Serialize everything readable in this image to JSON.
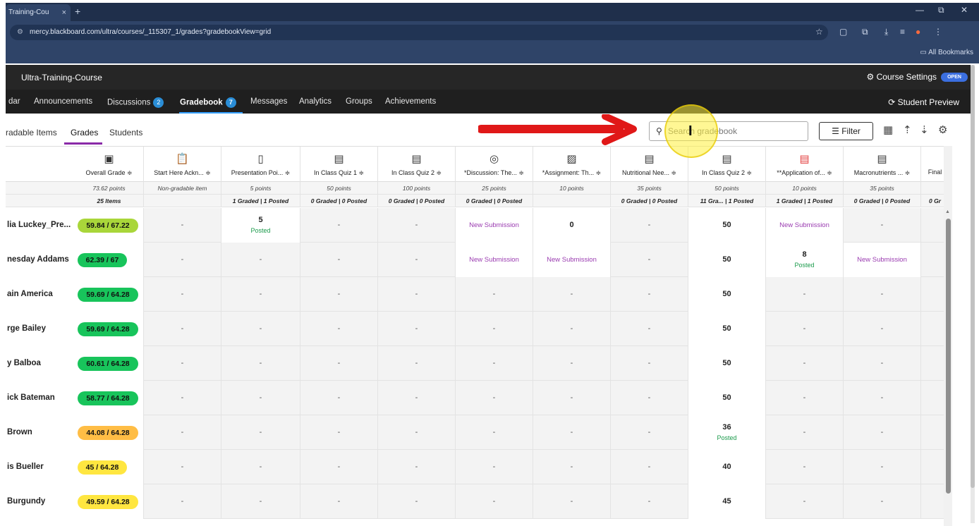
{
  "browser": {
    "tab_title": "Training-Cou",
    "tab_close": "×",
    "new_tab": "+",
    "url": "mercy.blackboard.com/ultra/courses/_115307_1/grades?gradebookView=grid",
    "bookmarks_label": "All Bookmarks",
    "minimize": "—",
    "restore": "⧉",
    "close": "✕"
  },
  "course": {
    "title": "Ultra-Training-Course",
    "settings_label": "Course Settings",
    "open_badge": "OPEN",
    "student_preview": "Student Preview"
  },
  "nav": {
    "items": [
      {
        "label": "dar"
      },
      {
        "label": "Announcements"
      },
      {
        "label": "Discussions",
        "badge": "2"
      },
      {
        "label": "Gradebook",
        "badge": "7"
      },
      {
        "label": "Messages"
      },
      {
        "label": "Analytics"
      },
      {
        "label": "Groups"
      },
      {
        "label": "Achievements"
      }
    ]
  },
  "subtabs": [
    "radable Items",
    "Grades",
    "Students"
  ],
  "search": {
    "placeholder": "Search gradebook"
  },
  "filter_label": "Filter",
  "columns": [
    {
      "name": "Overall Grade ≑",
      "points": "73.62 points",
      "status": "25 Items",
      "icon": "overall-grade-icon"
    },
    {
      "name": "Start Here Ackn... ≑",
      "points": "Non-gradable item",
      "status": "",
      "icon": "clipboard-icon"
    },
    {
      "name": "Presentation Poi... ≑",
      "points": "5 points",
      "status": "1 Graded | 1 Posted",
      "icon": "document-icon"
    },
    {
      "name": "In Class Quiz 1 ≑",
      "points": "50 points",
      "status": "0 Graded | 0 Posted",
      "icon": "quiz-icon"
    },
    {
      "name": "In Class Quiz 2 ≑",
      "points": "100 points",
      "status": "0 Graded | 0 Posted",
      "icon": "quiz-icon"
    },
    {
      "name": "*Discussion: The... ≑",
      "points": "25 points",
      "status": "0 Graded | 0 Posted",
      "icon": "discussion-icon"
    },
    {
      "name": "*Assignment: Th... ≑",
      "points": "10 points",
      "status": "",
      "icon": "assignment-icon"
    },
    {
      "name": "Nutritional Nee... ≑",
      "points": "35 points",
      "status": "0 Graded | 0 Posted",
      "icon": "quiz-icon"
    },
    {
      "name": "In Class Quiz 2 ≑",
      "points": "50 points",
      "status": "11 Gra... | 1 Posted",
      "icon": "quiz-icon"
    },
    {
      "name": "**Application of... ≑",
      "points": "10 points",
      "status": "1 Graded | 1 Posted",
      "icon": "assignment-red-icon"
    },
    {
      "name": "Macronutrients ... ≑",
      "points": "35 points",
      "status": "0 Graded | 0 Posted",
      "icon": "quiz-icon"
    },
    {
      "name": "Final",
      "points": "",
      "status": "0 Gr",
      "icon": ""
    }
  ],
  "students": [
    {
      "name": "lia Luckey_Pre...",
      "overall": "59.84 / 67.22",
      "color": "lime",
      "cells": [
        "-",
        "5|Posted",
        "-",
        "-",
        "New Submission",
        "0",
        "-",
        "50",
        "New Submission",
        "-"
      ]
    },
    {
      "name": "nesday Addams",
      "overall": "62.39 / 67",
      "color": "green",
      "cells": [
        "-",
        "-",
        "-",
        "-",
        "New Submission",
        "New Submission",
        "-",
        "50",
        "8|Posted",
        "New Submission"
      ]
    },
    {
      "name": "ain America",
      "overall": "59.69 / 64.28",
      "color": "green",
      "cells": [
        "-",
        "-",
        "-",
        "-",
        "-",
        "-",
        "-",
        "50",
        "-",
        "-"
      ]
    },
    {
      "name": "rge Bailey",
      "overall": "59.69 / 64.28",
      "color": "green",
      "cells": [
        "-",
        "-",
        "-",
        "-",
        "-",
        "-",
        "-",
        "50",
        "-",
        "-"
      ]
    },
    {
      "name": "y Balboa",
      "overall": "60.61 / 64.28",
      "color": "green",
      "cells": [
        "-",
        "-",
        "-",
        "-",
        "-",
        "-",
        "-",
        "50",
        "-",
        "-"
      ]
    },
    {
      "name": "ick Bateman",
      "overall": "58.77 / 64.28",
      "color": "green",
      "cells": [
        "-",
        "-",
        "-",
        "-",
        "-",
        "-",
        "-",
        "50",
        "-",
        "-"
      ]
    },
    {
      "name": "Brown",
      "overall": "44.08 / 64.28",
      "color": "orange",
      "cells": [
        "-",
        "-",
        "-",
        "-",
        "-",
        "-",
        "-",
        "36|Posted",
        "-",
        "-"
      ]
    },
    {
      "name": "is Bueller",
      "overall": "45 / 64.28",
      "color": "yellow",
      "cells": [
        "-",
        "-",
        "-",
        "-",
        "-",
        "-",
        "-",
        "40",
        "-",
        "-"
      ]
    },
    {
      "name": "Burgundy",
      "overall": "49.59 / 64.28",
      "color": "yellow",
      "cells": [
        "-",
        "-",
        "-",
        "-",
        "-",
        "-",
        "-",
        "45",
        "-",
        "-"
      ]
    }
  ]
}
